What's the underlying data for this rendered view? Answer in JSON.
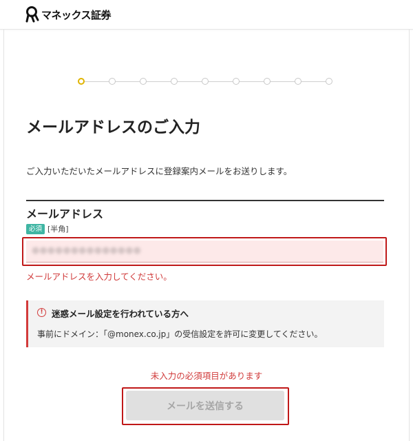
{
  "header": {
    "logo_text": "マネックス証券",
    "logo_icon": "monex-logo-icon"
  },
  "stepper": {
    "total_steps": 9,
    "current_step": 1,
    "active_color": "#e0b400"
  },
  "page": {
    "title": "メールアドレスのご入力",
    "intro": "ご入力いただいたメールアドレスに登録案内メールをお送りします。"
  },
  "email_field": {
    "label": "メールアドレス",
    "required_badge": "必須",
    "input_hint": "[半角]",
    "error": "メールアドレスを入力してください。"
  },
  "notice": {
    "icon": "alert-circle-icon",
    "title": "迷惑メール設定を行われている方へ",
    "body": "事前にドメイン：「@monex.co.jp」の受信設定を許可に変更してください。"
  },
  "form": {
    "error": "未入力の必須項目があります",
    "submit_label": "メールを送信する"
  },
  "colors": {
    "error_red": "#d03a3a",
    "required_badge_green": "#3fb5a3",
    "input_error_bg": "#fde9e9"
  }
}
